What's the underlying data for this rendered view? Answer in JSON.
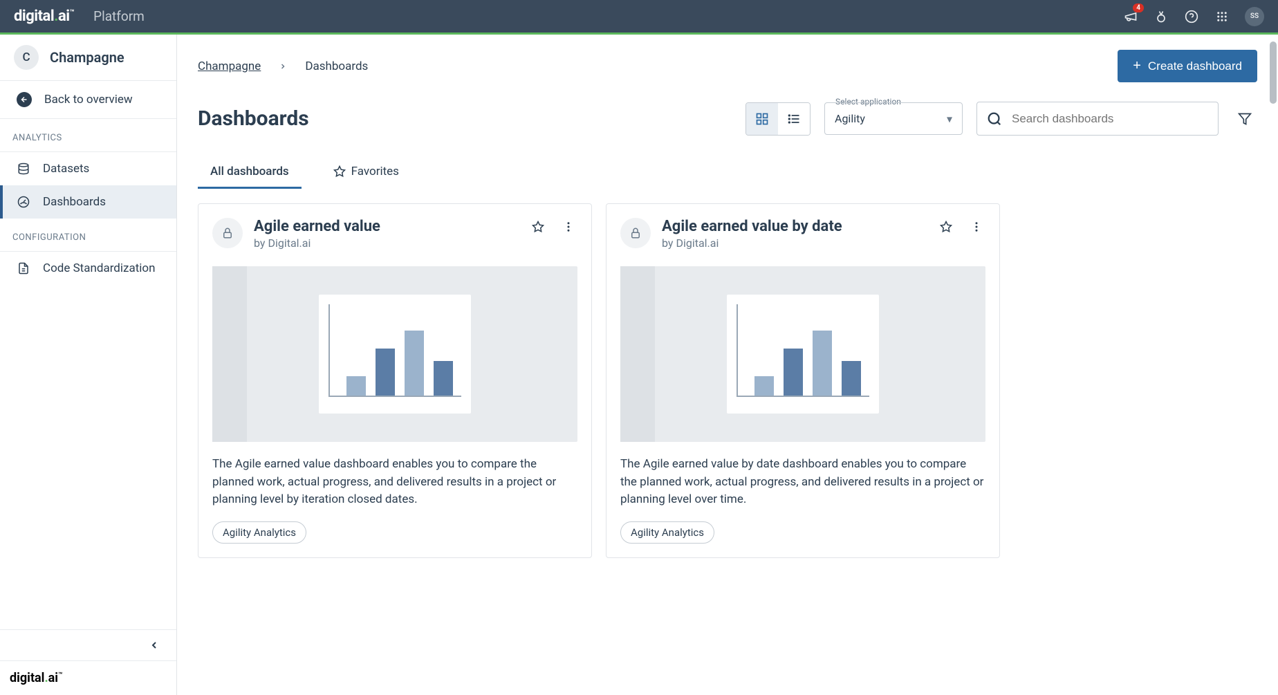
{
  "topbar": {
    "logo_text": "digital.ai",
    "product": "Platform",
    "notification_count": "4",
    "avatar_initials": "SS"
  },
  "sidebar": {
    "org_initial": "C",
    "org_name": "Champagne",
    "back_label": "Back to overview",
    "sections": {
      "analytics_label": "ANALYTICS",
      "configuration_label": "CONFIGURATION"
    },
    "items": {
      "datasets": "Datasets",
      "dashboards": "Dashboards",
      "code_std": "Code Standardization"
    },
    "footer_logo": "digital.ai"
  },
  "breadcrumb": {
    "root": "Champagne",
    "current": "Dashboards"
  },
  "actions": {
    "create_dashboard": "Create dashboard"
  },
  "page": {
    "title": "Dashboards",
    "select_label": "Select application",
    "select_value": "Agility",
    "search_placeholder": "Search dashboards"
  },
  "tabs": {
    "all": "All dashboards",
    "favorites": "Favorites"
  },
  "cards": [
    {
      "title": "Agile earned value",
      "by": "by Digital.ai",
      "desc": "The Agile earned value dashboard enables you to compare the planned work, actual progress, and delivered results in a project or planning level by iteration closed dates.",
      "tag": "Agility Analytics"
    },
    {
      "title": "Agile earned value by date",
      "by": "by Digital.ai",
      "desc": "The Agile earned value by date dashboard enables you to compare the planned work, actual progress, and delivered results in a project or planning level over time.",
      "tag": "Agility Analytics"
    }
  ]
}
